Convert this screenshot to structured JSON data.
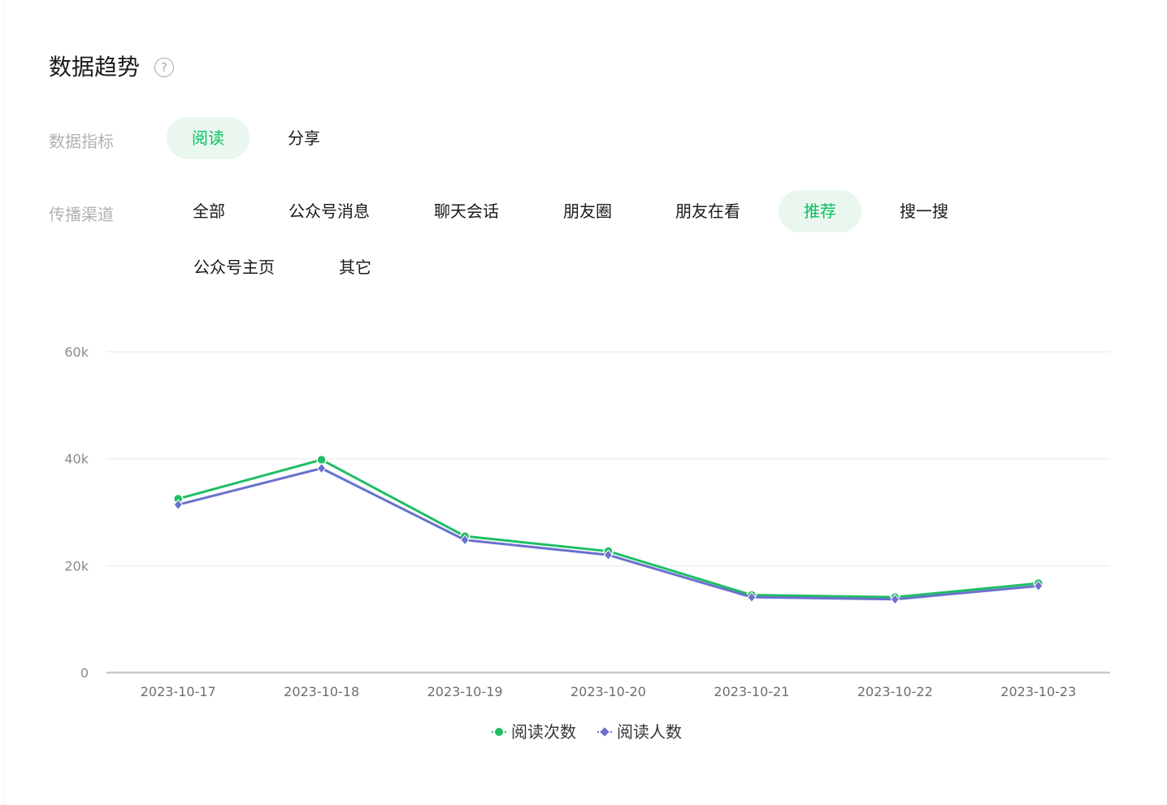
{
  "header": {
    "title": "数据趋势",
    "help_icon": "question-circle-icon",
    "help_glyph": "?"
  },
  "metric": {
    "label": "数据指标",
    "options": [
      {
        "label": "阅读",
        "active": true
      },
      {
        "label": "分享",
        "active": false
      }
    ]
  },
  "channel": {
    "label": "传播渠道",
    "options": [
      {
        "label": "全部",
        "active": false
      },
      {
        "label": "公众号消息",
        "active": false
      },
      {
        "label": "聊天会话",
        "active": false
      },
      {
        "label": "朋友圈",
        "active": false
      },
      {
        "label": "朋友在看",
        "active": false
      },
      {
        "label": "推荐",
        "active": true
      },
      {
        "label": "搜一搜",
        "active": false
      },
      {
        "label": "公众号主页",
        "active": false
      },
      {
        "label": "其它",
        "active": false
      }
    ]
  },
  "colors": {
    "accent": "#07c160",
    "accent_bg": "#e9f7ef",
    "series_reads": "#1fbe64",
    "series_readers": "#6a72cc"
  },
  "chart_data": {
    "type": "line",
    "x": [
      "2023-10-17",
      "2023-10-18",
      "2023-10-19",
      "2023-10-20",
      "2023-10-21",
      "2023-10-22",
      "2023-10-23"
    ],
    "series": [
      {
        "name": "阅读次数",
        "values": [
          32500,
          39800,
          25500,
          22700,
          14500,
          14100,
          16700
        ],
        "color": "#1fbe64",
        "marker": "circle"
      },
      {
        "name": "阅读人数",
        "values": [
          31400,
          38200,
          24800,
          22000,
          14100,
          13700,
          16200
        ],
        "color": "#6a72cc",
        "marker": "diamond"
      }
    ],
    "ylim": [
      0,
      60000
    ],
    "yticks": [
      {
        "value": 0,
        "label": "0"
      },
      {
        "value": 20000,
        "label": "20k"
      },
      {
        "value": 40000,
        "label": "40k"
      },
      {
        "value": 60000,
        "label": "60k"
      }
    ],
    "grid": true,
    "legend": "bottom-center"
  }
}
